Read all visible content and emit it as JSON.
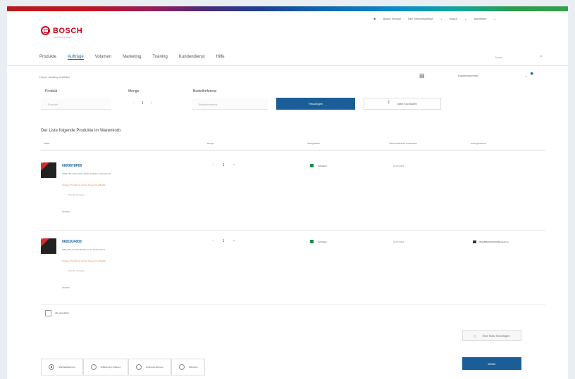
{
  "brand": {
    "name": "BOSCH",
    "tagline": "Technik fürs Leben"
  },
  "topbar": {
    "account": "Bosch Service",
    "info": "Ihre Serviceadresse",
    "lang": "Bosch",
    "user": "Abmelden"
  },
  "nav": {
    "items": [
      {
        "label": "Produkte"
      },
      {
        "label": "Aufträge"
      },
      {
        "label": "Volumen"
      },
      {
        "label": "Marketing"
      },
      {
        "label": "Training"
      },
      {
        "label": "Kundendienst"
      },
      {
        "label": "Hilfe"
      }
    ]
  },
  "search": {
    "placeholder": "Suche"
  },
  "breadcrumb": "Home / Auftrag erstellen",
  "store_select": "Kundennummer",
  "form": {
    "product_label": "Produkt",
    "product_placeholder": "Produkt",
    "qty_label": "Menge",
    "qty_value": "1",
    "ref_label": "Bestellreferenz",
    "ref_placeholder": "Bestellreferenz",
    "add_button": "Hinzufügen",
    "upload_button": "Datei hochladen"
  },
  "section_title": "Der Liste folgende Produkte im Warenkorb",
  "table": {
    "headers": [
      "Artikel",
      "Menge",
      "Verfügbarkeit",
      "Voraussichtliches Lieferdatum",
      "Auftragsreferenz"
    ],
    "rows": [
      {
        "badge": "Aktion",
        "name": "0600878P00",
        "desc": "GWS 18V-10 SC Akku-Winkelschleifer, Professional",
        "warn": "Hinweis: Produkt ist derzeit begrenzt verfügbar",
        "link": "Zubehör anzeigen",
        "link2": "Löschen",
        "qty": "1",
        "avail": "Verfügbar",
        "date": "24.07.2023",
        "ref": ""
      },
      {
        "badge": "Aktion",
        "name": "06019J4003",
        "desc": "GBH 18V-21 Akku-Bohrhammer, Professional",
        "warn": "Hinweis: Produkt ist derzeit begrenzt verfügbar",
        "link": "Zubehör anzeigen",
        "link2": "Löschen",
        "qty": "1",
        "avail": "Verfügbar",
        "date": "24.07.2023",
        "ref": "0601BB0000000000Bestellung"
      }
    ]
  },
  "select_all": "Alle auswählen",
  "notes_button": "Eine Notiz hinzufügen",
  "footer_options": [
    {
      "label": "Standardlieferung",
      "checked": true
    },
    {
      "label": "Teillieferung zulassen",
      "checked": false
    },
    {
      "label": "Express-Lieferung",
      "checked": false
    },
    {
      "label": "Abholung",
      "checked": false
    }
  ],
  "submit_button": "Weiter",
  "colors": {
    "accent": "#1b5e97",
    "brand_red": "#c90019",
    "available": "#1f8a4c",
    "warning": "#e07b3f"
  }
}
